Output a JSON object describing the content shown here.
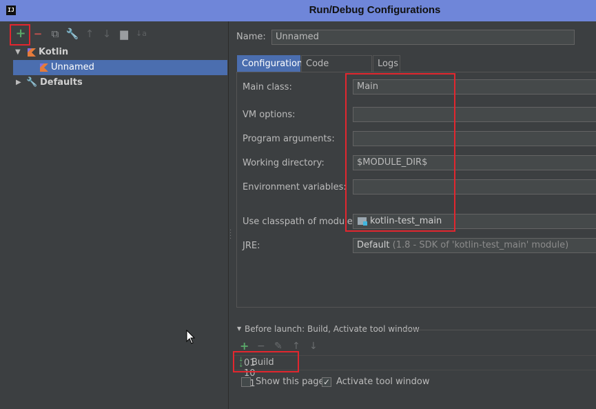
{
  "window": {
    "title": "Run/Debug Configurations",
    "app_icon_text": "IJ"
  },
  "toolbar": {
    "add": "+",
    "remove": "−",
    "copy": "⧉",
    "edit_defaults": "🔧",
    "move_up": "↑",
    "move_down": "↓",
    "folder": "▆",
    "sort": "↓a"
  },
  "tree": [
    {
      "label": "Kotlin",
      "icon": "kotlin-icon",
      "expanded": true
    },
    {
      "label": "Unnamed",
      "icon": "kotlin-icon",
      "selected": true
    },
    {
      "label": "Defaults",
      "icon": "wrench-icon",
      "expanded": false
    }
  ],
  "name_field": {
    "label": "Name:",
    "value": "Unnamed"
  },
  "tabs": [
    "Configuration",
    "Code Coverage",
    "Logs"
  ],
  "config": {
    "main_class": {
      "label": "Main class:",
      "value": "Main"
    },
    "vm_options": {
      "label": "VM options:",
      "value": ""
    },
    "program_arguments": {
      "label": "Program arguments:",
      "value": ""
    },
    "working_directory": {
      "label": "Working directory:",
      "value": "$MODULE_DIR$"
    },
    "environment_variables": {
      "label": "Environment variables:",
      "value": ""
    },
    "classpath_module": {
      "label": "Use classpath of module:",
      "value": "kotlin-test_main"
    },
    "jre": {
      "label": "JRE:",
      "value": "Default",
      "hint": "(1.8 - SDK of 'kotlin-test_main' module)"
    }
  },
  "before_launch": {
    "title": "Before launch: Build, Activate tool window",
    "items": [
      "Build"
    ],
    "show_this_page": {
      "label": "Show this page",
      "checked": false
    },
    "activate_tool_window": {
      "label": "Activate tool window",
      "checked": true
    }
  }
}
